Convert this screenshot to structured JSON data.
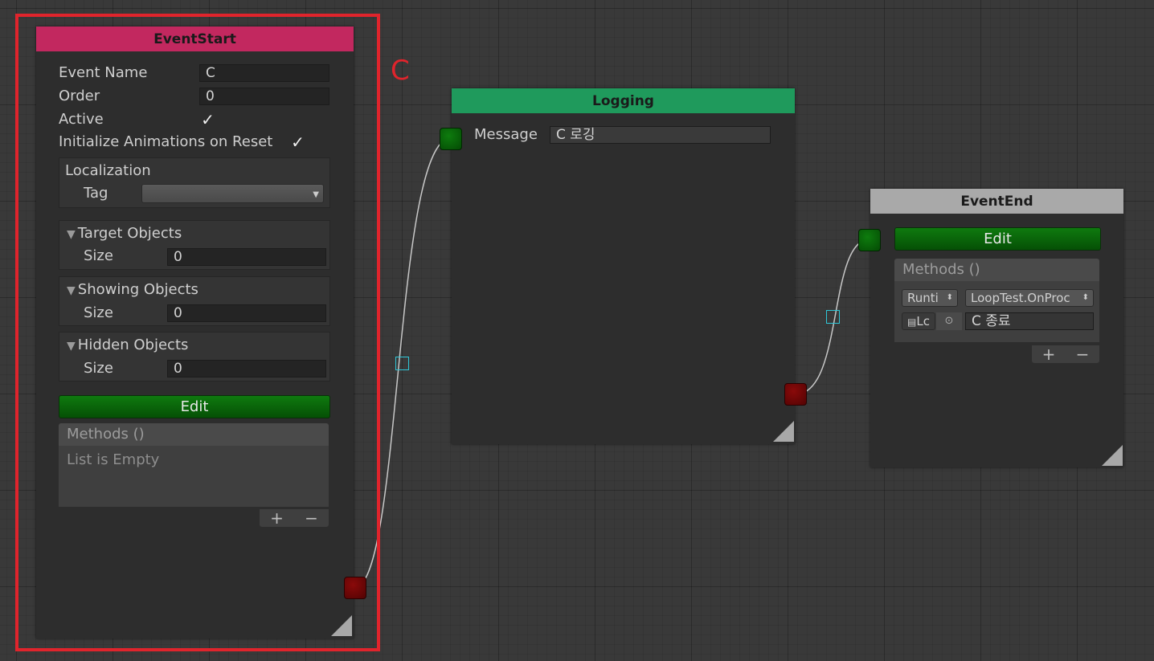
{
  "event_start": {
    "title": "EventStart",
    "event_name_label": "Event Name",
    "event_name_value": "C",
    "order_label": "Order",
    "order_value": "0",
    "active_label": "Active",
    "active_checked": true,
    "init_anim_label": "Initialize Animations on Reset",
    "init_anim_checked": true,
    "localization_label": "Localization",
    "tag_label": "Tag",
    "tag_value": "",
    "target_objects_label": "Target Objects",
    "target_size_label": "Size",
    "target_size_value": "0",
    "showing_objects_label": "Showing Objects",
    "showing_size_label": "Size",
    "showing_size_value": "0",
    "hidden_objects_label": "Hidden Objects",
    "hidden_size_label": "Size",
    "hidden_size_value": "0",
    "edit_label": "Edit",
    "methods_label": "Methods ()",
    "list_empty_label": "List is Empty",
    "plus_label": "+",
    "minus_label": "−",
    "header_color": "#c2285f"
  },
  "annotation_letter": "C",
  "logging": {
    "title": "Logging",
    "message_label": "Message",
    "message_value": "C 로깅",
    "header_color": "#1f9a5c"
  },
  "event_end": {
    "title": "EventEnd",
    "edit_label": "Edit",
    "methods_label": "Methods ()",
    "runtime_dropdown": "Runti",
    "function_dropdown": "LoopTest.OnProc",
    "object_field": "Lc",
    "string_value": "C 종료",
    "plus_label": "+",
    "minus_label": "−",
    "header_color": "#a9a9a9"
  },
  "highlight_color": "#e0242c",
  "wire_handle_color": "#2fc7d8"
}
